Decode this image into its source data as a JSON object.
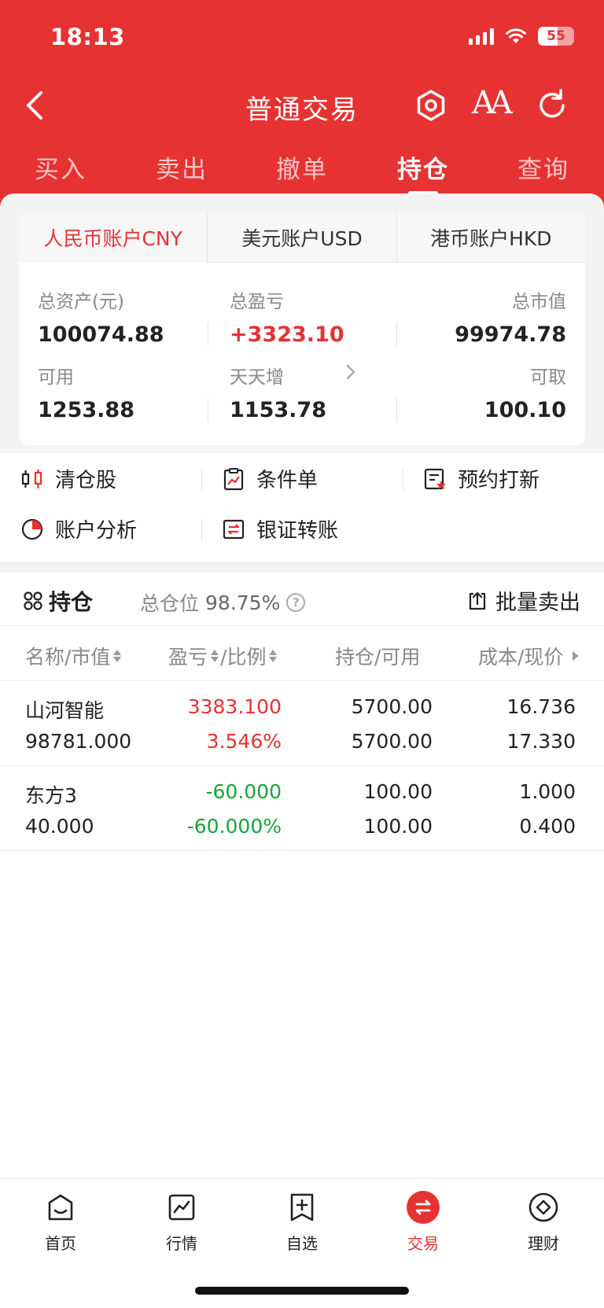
{
  "status_bar": {
    "time": "18:13",
    "battery": "55",
    "battery_level": 0.55
  },
  "nav": {
    "title": "普通交易",
    "back_icon": "chevron-left-icon",
    "settings_icon": "hexagon-settings-icon",
    "font_icon": "font-size-icon",
    "refresh_icon": "refresh-icon"
  },
  "main_tabs": [
    {
      "label": "买入",
      "active": false
    },
    {
      "label": "卖出",
      "active": false
    },
    {
      "label": "撤单",
      "active": false
    },
    {
      "label": "持仓",
      "active": true
    },
    {
      "label": "查询",
      "active": false
    }
  ],
  "accounts": {
    "tabs": [
      {
        "label": "人民币账户CNY",
        "active": true
      },
      {
        "label": "美元账户USD",
        "active": false
      },
      {
        "label": "港币账户HKD",
        "active": false
      }
    ],
    "total_assets_label": "总资产(元)",
    "total_assets": "100074.88",
    "total_pl_label": "总盈亏",
    "total_pl": "+3323.10",
    "market_value_label": "总市值",
    "market_value": "99974.78",
    "available_label": "可用",
    "available": "1253.88",
    "tiantianzeng_label": "天天增",
    "tiantianzeng": "1153.78",
    "withdrawable_label": "可取",
    "withdrawable": "100.10"
  },
  "functions": [
    {
      "label": "清仓股",
      "icon": "clear-stock-icon"
    },
    {
      "label": "条件单",
      "icon": "condition-order-icon"
    },
    {
      "label": "预约打新",
      "icon": "ipo-reserve-icon"
    },
    {
      "label": "账户分析",
      "icon": "pie-chart-icon"
    },
    {
      "label": "银证转账",
      "icon": "transfer-icon"
    }
  ],
  "holdings": {
    "title": "持仓",
    "ratio_label": "总仓位",
    "ratio_value": "98.75%",
    "batch_sell": "批量卖出",
    "columns": {
      "name": "名称/市值",
      "pl": "盈亏",
      "ratio": "/比例",
      "position": "持仓/可用",
      "cost": "成本/现价"
    },
    "rows": [
      {
        "name": "山河智能",
        "market_value": "98781.000",
        "pl": "3383.100",
        "pl_ratio": "3.546%",
        "position": "5700.00",
        "available": "5700.00",
        "cost": "16.736",
        "price": "17.330",
        "trend": "up"
      },
      {
        "name": "东方3",
        "market_value": "40.000",
        "pl": "-60.000",
        "pl_ratio": "-60.000%",
        "position": "100.00",
        "available": "100.00",
        "cost": "1.000",
        "price": "0.400",
        "trend": "down"
      }
    ]
  },
  "bottom_nav": [
    {
      "label": "首页",
      "icon": "home-icon",
      "active": false
    },
    {
      "label": "行情",
      "icon": "market-chart-icon",
      "active": false
    },
    {
      "label": "自选",
      "icon": "watchlist-add-icon",
      "active": false
    },
    {
      "label": "交易",
      "icon": "trade-icon",
      "active": true
    },
    {
      "label": "理财",
      "icon": "wealth-icon",
      "active": false
    }
  ],
  "colors": {
    "brand_red": "#e63232",
    "loss_green": "#18a33c"
  }
}
